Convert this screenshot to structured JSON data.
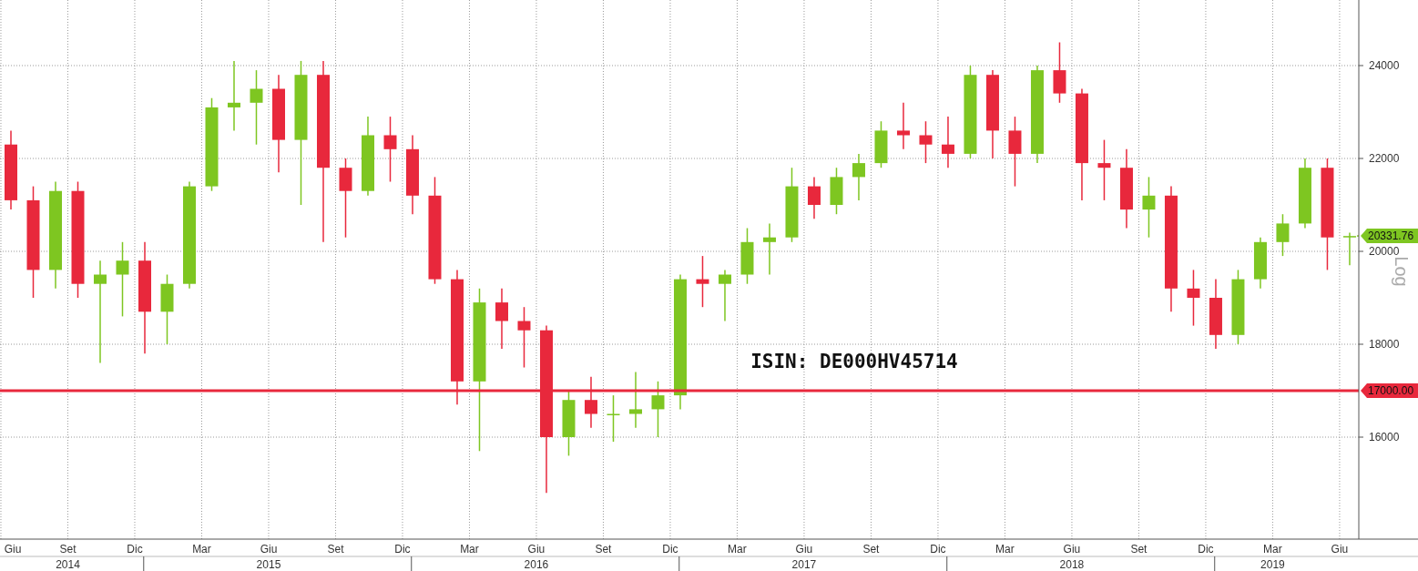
{
  "chart": {
    "chart_data": {
      "type": "candlestick",
      "ylabel": "Log",
      "ylim": [
        13804,
        25412
      ],
      "grid": true,
      "ref_lines": [
        {
          "axis": "y",
          "value": 17000,
          "label": "17000.00",
          "color": "#e8283c"
        }
      ],
      "yticks": [
        {
          "value": 16000,
          "label": "16000"
        },
        {
          "value": 18000,
          "label": "18000"
        },
        {
          "value": 20000,
          "label": "20000"
        },
        {
          "value": 22000,
          "label": "22000"
        },
        {
          "value": 24000,
          "label": "24000"
        }
      ],
      "categories": [
        null,
        null,
        null,
        null,
        null,
        null,
        null,
        null,
        null,
        null,
        null,
        null,
        null,
        null,
        null,
        null,
        null,
        null,
        null,
        null,
        null,
        null,
        null,
        null,
        null,
        null,
        null,
        null,
        null,
        null,
        null,
        null,
        null,
        null,
        null,
        null,
        null,
        null,
        null,
        null,
        null,
        null,
        null,
        null,
        null,
        null,
        null,
        null,
        null,
        null,
        null,
        null,
        null,
        null,
        null,
        null,
        null,
        null,
        null,
        null,
        null
      ],
      "ohlc": [
        [
          22300,
          22600,
          20900,
          21100
        ],
        [
          21100,
          21400,
          19000,
          19600
        ],
        [
          19600,
          21500,
          19200,
          21300
        ],
        [
          21300,
          21500,
          19000,
          19300
        ],
        [
          19300,
          19800,
          17600,
          19500
        ],
        [
          19500,
          20200,
          18600,
          19800
        ],
        [
          19800,
          20200,
          17800,
          18700
        ],
        [
          18700,
          19500,
          18000,
          19300
        ],
        [
          19300,
          21500,
          19200,
          21400
        ],
        [
          21400,
          23300,
          21300,
          23100
        ],
        [
          23100,
          24100,
          22600,
          23200
        ],
        [
          23200,
          23900,
          22300,
          23500
        ],
        [
          23500,
          23800,
          21700,
          22400
        ],
        [
          22400,
          24100,
          21000,
          23800
        ],
        [
          23800,
          24100,
          20200,
          21800
        ],
        [
          21800,
          22000,
          20300,
          21300
        ],
        [
          21300,
          22900,
          21200,
          22500
        ],
        [
          22500,
          22900,
          21500,
          22200
        ],
        [
          22200,
          22500,
          20800,
          21200
        ],
        [
          21200,
          21600,
          19300,
          19400
        ],
        [
          19400,
          19600,
          16700,
          17200
        ],
        [
          17200,
          19200,
          15700,
          18900
        ],
        [
          18900,
          19200,
          17900,
          18500
        ],
        [
          18500,
          18800,
          17500,
          18300
        ],
        [
          18300,
          18400,
          14800,
          16000
        ],
        [
          16000,
          17000,
          15600,
          16800
        ],
        [
          16800,
          17300,
          16200,
          16500
        ],
        [
          16500,
          16900,
          15900,
          16500
        ],
        [
          16500,
          17400,
          16200,
          16600
        ],
        [
          16600,
          17200,
          16000,
          16900
        ],
        [
          16900,
          19500,
          16600,
          19400
        ],
        [
          19400,
          19900,
          18800,
          19300
        ],
        [
          19300,
          19600,
          18500,
          19500
        ],
        [
          19500,
          20500,
          19300,
          20200
        ],
        [
          20200,
          20600,
          19500,
          20300
        ],
        [
          20300,
          21800,
          20200,
          21400
        ],
        [
          21400,
          21600,
          20700,
          21000
        ],
        [
          21000,
          21800,
          20800,
          21600
        ],
        [
          21600,
          22100,
          21100,
          21900
        ],
        [
          21900,
          22800,
          21800,
          22600
        ],
        [
          22600,
          23200,
          22200,
          22500
        ],
        [
          22500,
          22800,
          21900,
          22300
        ],
        [
          22300,
          22900,
          21800,
          22100
        ],
        [
          22100,
          24000,
          22000,
          23800
        ],
        [
          23800,
          23900,
          22000,
          22600
        ],
        [
          22600,
          22900,
          21400,
          22100
        ],
        [
          22100,
          24000,
          21900,
          23900
        ],
        [
          23900,
          24500,
          23200,
          23400
        ],
        [
          23400,
          23500,
          21100,
          21900
        ],
        [
          21900,
          22400,
          21100,
          21800
        ],
        [
          21800,
          22200,
          20500,
          20900
        ],
        [
          20900,
          21600,
          20300,
          21200
        ],
        [
          21200,
          21400,
          18700,
          19200
        ],
        [
          19200,
          19600,
          18400,
          19000
        ],
        [
          19000,
          19400,
          17900,
          18200
        ],
        [
          18200,
          19600,
          18000,
          19400
        ],
        [
          19400,
          20300,
          19200,
          20200
        ],
        [
          20200,
          20800,
          19900,
          20600
        ],
        [
          20600,
          22000,
          20500,
          21800
        ],
        [
          21800,
          22000,
          19600,
          20300
        ],
        [
          20300,
          20400,
          19700,
          20330
        ]
      ]
    },
    "month_labels": [
      "Giu",
      "Set",
      "Dic",
      "Mar",
      "Giu",
      "Set",
      "Dic",
      "Mar",
      "Giu",
      "Set",
      "Dic",
      "Mar",
      "Giu",
      "Set",
      "Dic",
      "Mar",
      "Giu",
      "Set",
      "Dic",
      "Mar",
      "Giu"
    ],
    "year_labels": [
      "2014",
      "2015",
      "2016",
      "2017",
      "2018",
      "2019"
    ],
    "price_tags": [
      {
        "kind": "last",
        "label": "20331.76"
      }
    ],
    "annotation": "ISIN: DE000HV45714"
  }
}
